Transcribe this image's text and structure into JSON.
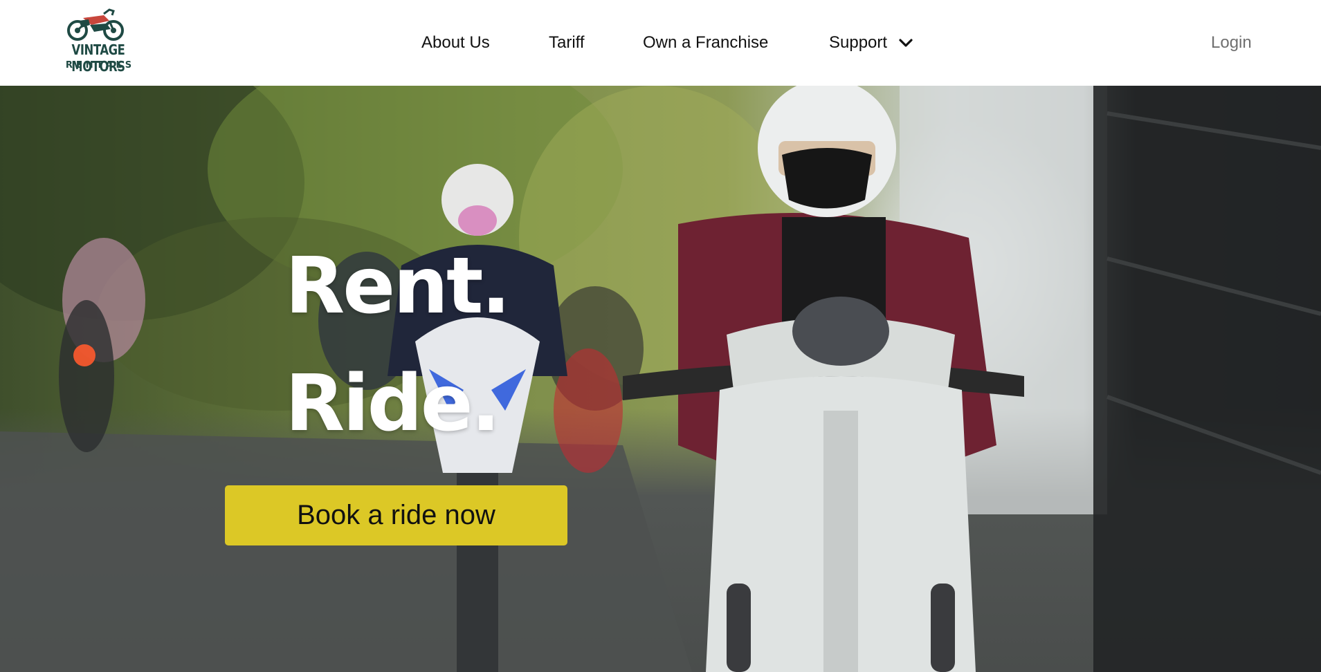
{
  "brand": {
    "name": "VINTAGE MOTORS",
    "sub": "RENTALS",
    "colors": {
      "primary": "#1f4a44",
      "accent": "#c8463c"
    }
  },
  "nav": {
    "items": [
      {
        "label": "About Us"
      },
      {
        "label": "Tariff"
      },
      {
        "label": "Own a Franchise"
      },
      {
        "label": "Support",
        "icon": "chevron-down-icon"
      }
    ],
    "login": "Login"
  },
  "hero": {
    "line1": "Rent.",
    "line2": "Ride.",
    "cta": "Book a ride now",
    "cta_color": "#dcc826",
    "image": "photo of riders on scooters on a tree-lined street"
  }
}
